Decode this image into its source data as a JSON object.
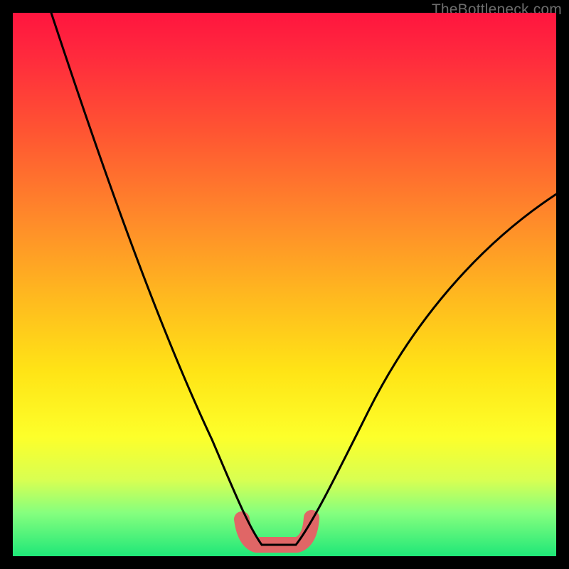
{
  "watermark": "TheBottleneck.com",
  "colors": {
    "frame": "#000000",
    "gradient_top": "#ff153f",
    "gradient_bottom": "#1fe778",
    "curve": "#000000",
    "flat_region": "#e06666"
  },
  "chart_data": {
    "type": "line",
    "title": "",
    "xlabel": "",
    "ylabel": "",
    "xlim": [
      0,
      100
    ],
    "ylim": [
      0,
      100
    ],
    "series": [
      {
        "name": "bottleneck-curve",
        "x": [
          0,
          5,
          10,
          15,
          20,
          25,
          30,
          35,
          38,
          40,
          43,
          45,
          47,
          49,
          51,
          54,
          58,
          62,
          68,
          75,
          82,
          90,
          100
        ],
        "y": [
          100,
          91,
          82,
          73,
          63,
          53,
          43,
          32,
          23,
          16,
          8,
          3,
          0,
          0,
          0,
          3,
          8,
          14,
          22,
          32,
          42,
          52,
          65
        ]
      }
    ],
    "annotations": [
      {
        "name": "flat-bottom-highlight",
        "x_range": [
          44,
          54
        ],
        "y": 0,
        "color": "#e06666"
      }
    ]
  }
}
